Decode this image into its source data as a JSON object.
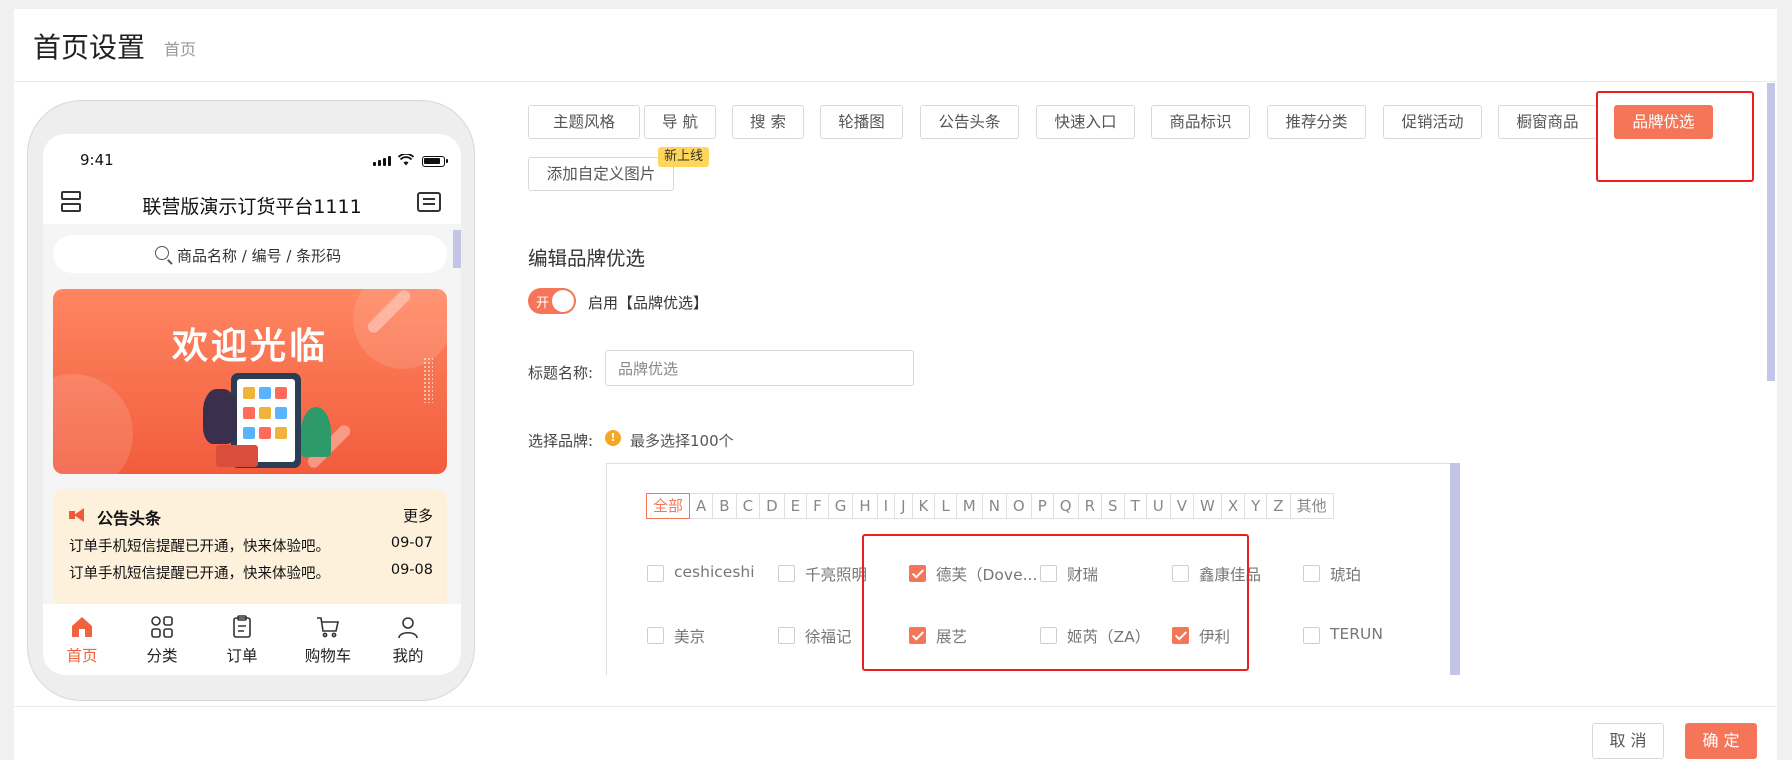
{
  "header": {
    "title": "首页设置",
    "breadcrumb": "首页"
  },
  "phone": {
    "time": "9:41",
    "app_title": "联营版演示订货平台1111",
    "search_placeholder": "商品名称 / 编号 / 条形码",
    "banner_text": "欢迎光临",
    "notice": {
      "title": "公告头条",
      "more": "更多",
      "items": [
        {
          "text": "订单手机短信提醒已开通，快来体验吧。",
          "date": "09-07"
        },
        {
          "text": "订单手机短信提醒已开通，快来体验吧。",
          "date": "09-08"
        }
      ]
    },
    "tabbar": [
      {
        "label": "首页",
        "icon": "home-icon",
        "active": true
      },
      {
        "label": "分类",
        "icon": "category-icon",
        "active": false
      },
      {
        "label": "订单",
        "icon": "order-icon",
        "active": false
      },
      {
        "label": "购物车",
        "icon": "cart-icon",
        "active": false
      },
      {
        "label": "我的",
        "icon": "user-icon",
        "active": false
      }
    ]
  },
  "modules": {
    "items": [
      "主题风格",
      "导 航",
      "搜 索",
      "轮播图",
      "公告头条",
      "快速入口",
      "商品标识",
      "推荐分类",
      "促销活动",
      "橱窗商品",
      "品牌优选",
      "添加自定义图片"
    ],
    "active": "品牌优选",
    "new_badge": "新上线"
  },
  "editor": {
    "section_title": "编辑品牌优选",
    "toggle_on_text": "开",
    "toggle_label": "启用【品牌优选】",
    "title_label": "标题名称:",
    "title_value": "品牌优选",
    "brand_label": "选择品牌:",
    "brand_hint": "最多选择100个",
    "warn_glyph": "!"
  },
  "brand_filter": {
    "letters": [
      "全部",
      "A",
      "B",
      "C",
      "D",
      "E",
      "F",
      "G",
      "H",
      "I",
      "J",
      "K",
      "L",
      "M",
      "N",
      "O",
      "P",
      "Q",
      "R",
      "S",
      "T",
      "U",
      "V",
      "W",
      "X",
      "Y",
      "Z",
      "其他"
    ],
    "active": "全部"
  },
  "brands": {
    "items": [
      {
        "name": "ceshiceshi",
        "checked": false
      },
      {
        "name": "千亮照明",
        "checked": false
      },
      {
        "name": "德芙（Dove...",
        "checked": true
      },
      {
        "name": "财瑞",
        "checked": false
      },
      {
        "name": "鑫康佳品",
        "checked": false
      },
      {
        "name": "琥珀",
        "checked": false
      },
      {
        "name": "美京",
        "checked": false
      },
      {
        "name": "徐福记",
        "checked": false
      },
      {
        "name": "展艺",
        "checked": true
      },
      {
        "name": "姬芮（ZA）",
        "checked": false
      },
      {
        "name": "伊利",
        "checked": true
      },
      {
        "name": "TERUN",
        "checked": false
      }
    ]
  },
  "footer": {
    "cancel": "取 消",
    "confirm": "确 定"
  },
  "colors": {
    "accent": "#f57558",
    "highlight_box": "#e8211f",
    "badge": "#ffd65b",
    "scrollbar": "#c4c4e6"
  }
}
